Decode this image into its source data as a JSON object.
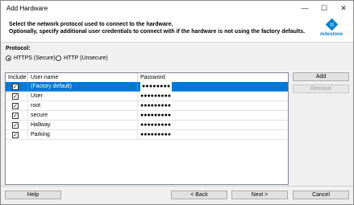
{
  "window": {
    "title": "Add Hardware",
    "minimize_glyph": "—",
    "maximize_glyph": "☐",
    "close_glyph": "✕"
  },
  "header": {
    "line1": "Select the network protocol used to connect to the hardware.",
    "line2": "Optionally, specify additional user credentials to connect with if the hardware is not using the factory defaults.",
    "logo_text": "milestone"
  },
  "protocol": {
    "label": "Protocol:",
    "options": [
      {
        "label": "HTTPS (Secure)",
        "selected": true
      },
      {
        "label": "HTTP (Unsecure)",
        "selected": false
      }
    ]
  },
  "table": {
    "columns": [
      "Include",
      "User name",
      "Password"
    ],
    "rows": [
      {
        "include": true,
        "user": "(Factory default)",
        "password": "●●●●●●●●",
        "selected": true
      },
      {
        "include": true,
        "user": "User",
        "password": "●●●●●●●●●",
        "selected": false
      },
      {
        "include": true,
        "user": "root",
        "password": "●●●●●●●●●",
        "selected": false
      },
      {
        "include": true,
        "user": "secure",
        "password": "●●●●●●●●●",
        "selected": false
      },
      {
        "include": true,
        "user": "Hallway",
        "password": "●●●●●●●●●",
        "selected": false
      },
      {
        "include": true,
        "user": "Parking",
        "password": "●●●●●●●●●",
        "selected": false
      }
    ]
  },
  "side_buttons": {
    "add": "Add",
    "remove": "Remove"
  },
  "footer": {
    "help": "Help",
    "back": "< Back",
    "next": "Next >",
    "cancel": "Cancel"
  },
  "colors": {
    "selection": "#0078d7",
    "brand": "#0c7fc6"
  }
}
